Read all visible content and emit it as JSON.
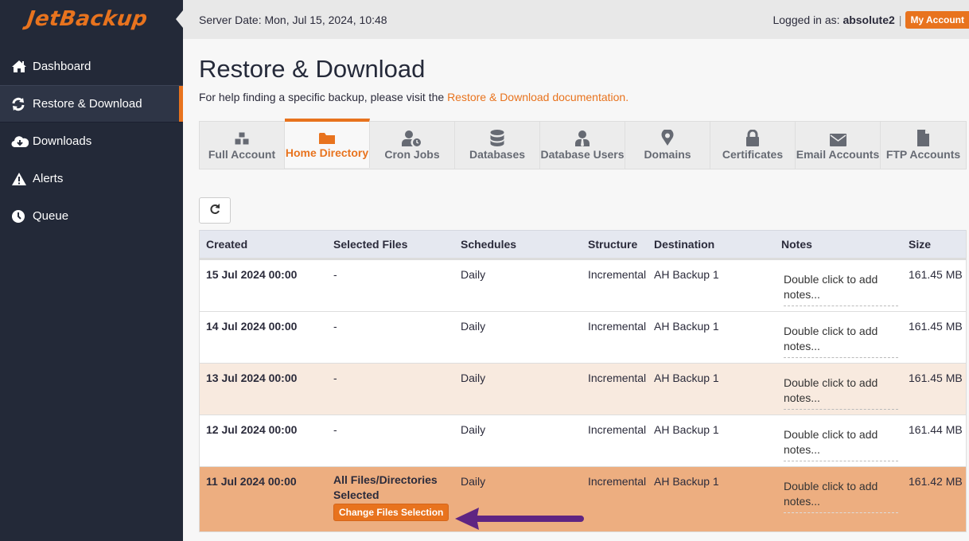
{
  "brand": {
    "logo": "JetBackup",
    "accent": "#e8731e",
    "sidebar_bg": "#232938"
  },
  "sidebar": {
    "items": [
      {
        "label": "Dashboard",
        "icon": "home-icon",
        "active": false
      },
      {
        "label": "Restore & Download",
        "icon": "refresh-icon",
        "active": true
      },
      {
        "label": "Downloads",
        "icon": "cloud-download-icon",
        "active": false
      },
      {
        "label": "Alerts",
        "icon": "warning-icon",
        "active": false
      },
      {
        "label": "Queue",
        "icon": "clock-icon",
        "active": false
      }
    ]
  },
  "topbar": {
    "server_date": "Server Date: Mon, Jul 15, 2024, 10:48",
    "logged_in_prefix": "Logged in as:",
    "username": "absolute2",
    "separator": "|",
    "my_account": "My Account"
  },
  "page": {
    "title": "Restore & Download",
    "help_text": "For help finding a specific backup, please visit the",
    "help_link": "Restore & Download documentation."
  },
  "tabs": [
    {
      "label": "Full Account",
      "icon": "cubes-icon",
      "active": false
    },
    {
      "label": "Home Directory",
      "icon": "folder-icon",
      "active": true
    },
    {
      "label": "Cron Jobs",
      "icon": "user-clock-icon",
      "active": false
    },
    {
      "label": "Databases",
      "icon": "database-icon",
      "active": false
    },
    {
      "label": "Database Users",
      "icon": "user-tie-icon",
      "active": false
    },
    {
      "label": "Domains",
      "icon": "map-marker-icon",
      "active": false
    },
    {
      "label": "Certificates",
      "icon": "lock-icon",
      "active": false
    },
    {
      "label": "Email Accounts",
      "icon": "envelope-icon",
      "active": false
    },
    {
      "label": "FTP Accounts",
      "icon": "file-icon",
      "active": false
    }
  ],
  "table": {
    "columns": [
      "Created",
      "Selected Files",
      "Schedules",
      "Structure",
      "Destination",
      "Notes",
      "Size"
    ],
    "rows": [
      {
        "created": "15 Jul 2024 00:00",
        "selected_files": "-",
        "schedules": "Daily",
        "structure": "Incremental",
        "destination": "AH Backup 1",
        "notes": "Double click to add notes...",
        "size": "161.45 MB",
        "state": "normal"
      },
      {
        "created": "14 Jul 2024 00:00",
        "selected_files": "-",
        "schedules": "Daily",
        "structure": "Incremental",
        "destination": "AH Backup 1",
        "notes": "Double click to add notes...",
        "size": "161.45 MB",
        "state": "normal"
      },
      {
        "created": "13 Jul 2024 00:00",
        "selected_files": "-",
        "schedules": "Daily",
        "structure": "Incremental",
        "destination": "AH Backup 1",
        "notes": "Double click to add notes...",
        "size": "161.45 MB",
        "state": "hover"
      },
      {
        "created": "12 Jul 2024 00:00",
        "selected_files": "-",
        "schedules": "Daily",
        "structure": "Incremental",
        "destination": "AH Backup 1",
        "notes": "Double click to add notes...",
        "size": "161.44 MB",
        "state": "normal"
      },
      {
        "created": "11 Jul 2024 00:00",
        "selected_files": "All Files/Directories Selected",
        "schedules": "Daily",
        "structure": "Incremental",
        "destination": "AH Backup 1",
        "notes": "Double click to add notes...",
        "size": "161.42 MB",
        "state": "selected",
        "action": "Change Files Selection"
      }
    ]
  },
  "annotation": {
    "type": "arrow",
    "color": "#5f2582",
    "points_to": "Change Files Selection"
  }
}
